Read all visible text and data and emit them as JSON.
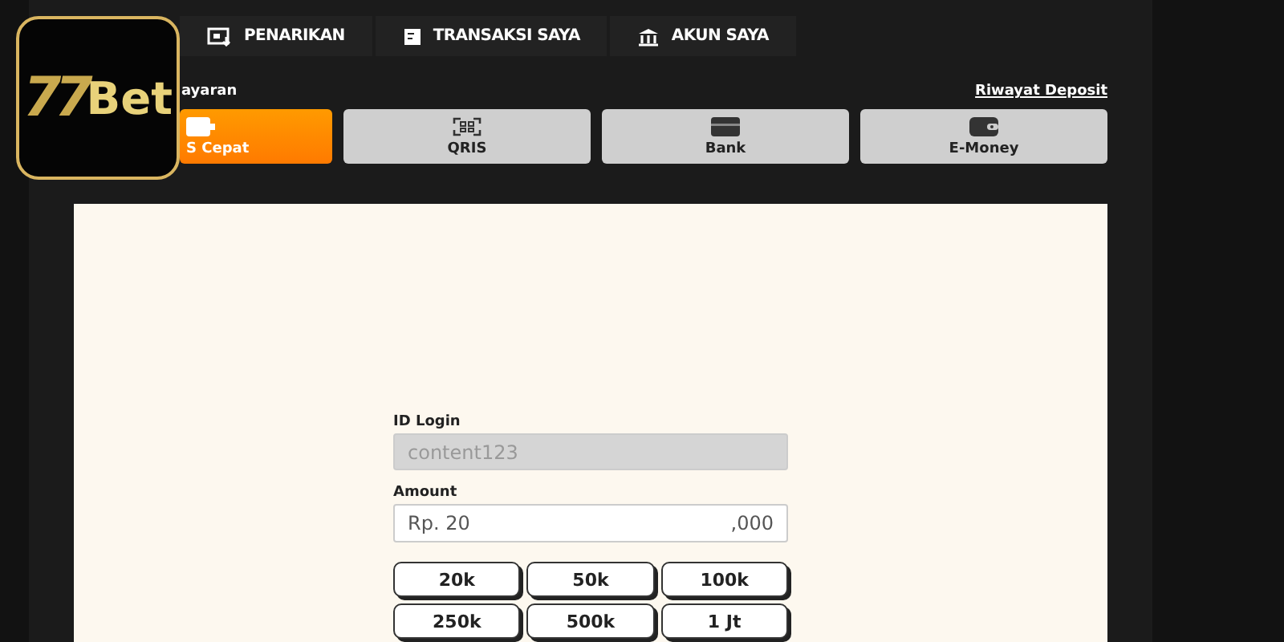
{
  "logo": {
    "number": "77",
    "word": "Bet"
  },
  "nav_tabs": [
    {
      "label": "PENARIKAN",
      "kind": "withdraw"
    },
    {
      "label": "TRANSAKSI SAYA",
      "kind": "transactions"
    },
    {
      "label": "AKUN SAYA",
      "kind": "account"
    }
  ],
  "section_label": "ayaran",
  "history_link": "Riwayat Deposit",
  "methods": [
    {
      "label": "S Cepat",
      "kind": "quick",
      "selected": true
    },
    {
      "label": "QRIS",
      "kind": "qris",
      "selected": false
    },
    {
      "label": "Bank",
      "kind": "bank",
      "selected": false
    },
    {
      "label": "E-Money",
      "kind": "emoney",
      "selected": false
    }
  ],
  "form": {
    "id_label": "ID Login",
    "id_value": "content123",
    "amount_label": "Amount",
    "amount_prefix": "Rp. 20",
    "amount_suffix": ",000",
    "presets": [
      "20k",
      "50k",
      "100k",
      "250k",
      "500k",
      "1 Jt"
    ]
  }
}
